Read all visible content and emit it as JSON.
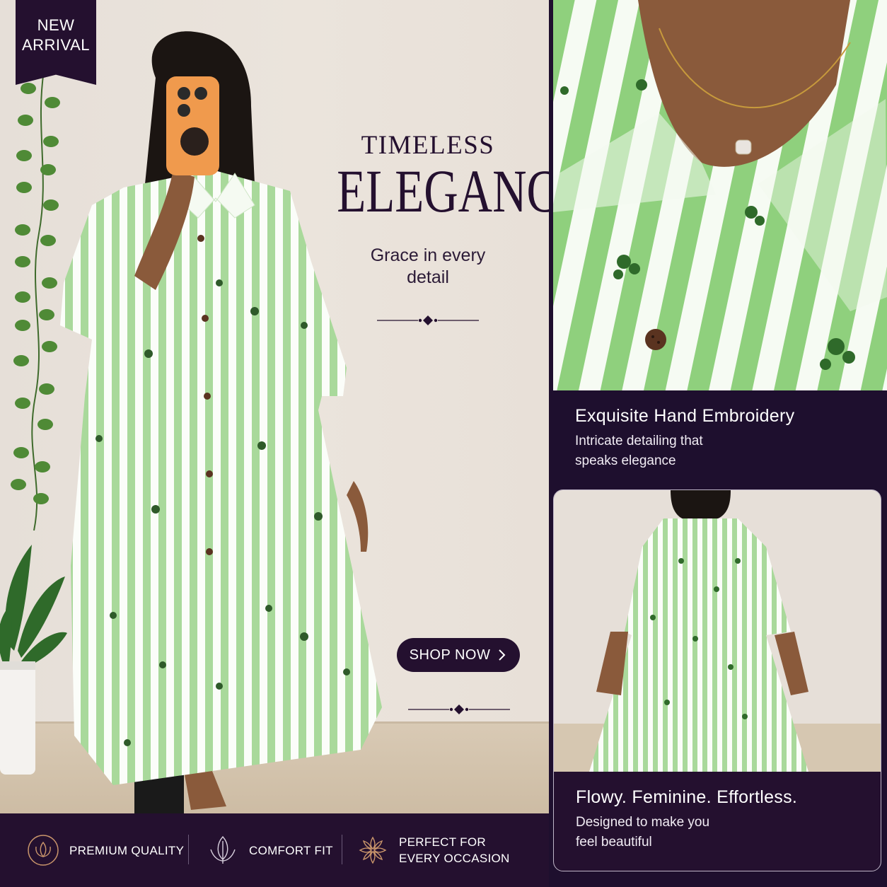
{
  "badge": {
    "line1": "NEW",
    "line2": "ARRIVAL"
  },
  "headline": {
    "small": "TIMELESS",
    "big": "ELEGANCE",
    "subtitle_line1": "Grace in every",
    "subtitle_line2": "detail"
  },
  "cta": {
    "label": "SHOP NOW",
    "icon": "chevron-right-icon"
  },
  "features": [
    {
      "icon": "lotus-icon",
      "line1": "PREMIUM QUALITY",
      "line2": ""
    },
    {
      "icon": "leaf-icon",
      "line1": "COMFORT FIT",
      "line2": ""
    },
    {
      "icon": "flower-icon",
      "line1": "PERFECT FOR",
      "line2": "EVERY OCCASION"
    }
  ],
  "panel1": {
    "title": "Exquisite Hand Embroidery",
    "desc_line1": "Intricate detailing that",
    "desc_line2": "speaks elegance"
  },
  "panel2": {
    "title": "Flowy. Feminine. Effortless.",
    "desc_line1": "Designed to make you",
    "desc_line2": "feel beautiful"
  },
  "colors": {
    "brand_dark": "#24102f",
    "stripe_green": "#a8d99a",
    "background_beige": "#e8e1da",
    "accent_gold": "#c9956b"
  }
}
